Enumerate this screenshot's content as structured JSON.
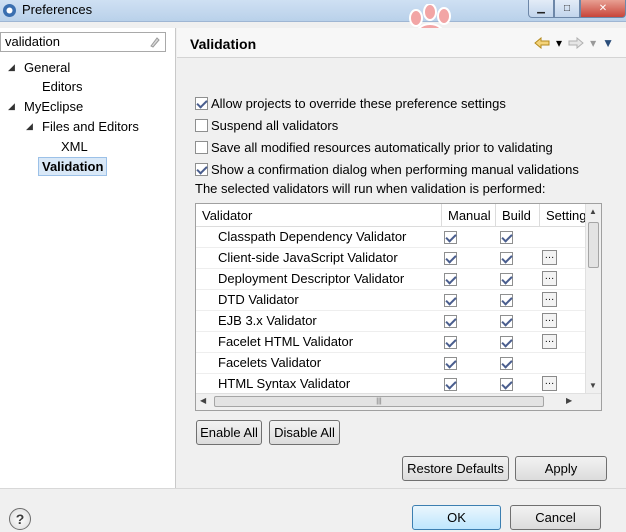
{
  "window": {
    "title": "Preferences",
    "min_glyph": "▁",
    "max_glyph": "□",
    "close_glyph": "✕"
  },
  "sidebar": {
    "filter_value": "validation",
    "tree": [
      {
        "label": "General",
        "expanded": true
      },
      {
        "label": "Editors"
      },
      {
        "label": "MyEclipse",
        "expanded": true
      },
      {
        "label": "Files and Editors",
        "expanded": true
      },
      {
        "label": "XML"
      },
      {
        "label": "Validation",
        "selected": true
      }
    ]
  },
  "page": {
    "title": "Validation",
    "options": [
      {
        "label": "Allow projects to override these preference settings",
        "checked": true
      },
      {
        "label": "Suspend all validators",
        "checked": false
      },
      {
        "label": "Save all modified resources automatically prior to validating",
        "checked": false
      },
      {
        "label": "Show a confirmation dialog when performing manual validations",
        "checked": true
      }
    ],
    "info_text": "The selected validators will run when validation is performed:",
    "table": {
      "columns": [
        "Validator",
        "Manual",
        "Build",
        "Settings"
      ],
      "rows": [
        {
          "name": "Classpath Dependency Validator",
          "manual": true,
          "build": true,
          "settings": false
        },
        {
          "name": "Client-side JavaScript Validator",
          "manual": true,
          "build": true,
          "settings": true
        },
        {
          "name": "Deployment Descriptor Validator",
          "manual": true,
          "build": true,
          "settings": true
        },
        {
          "name": "DTD Validator",
          "manual": true,
          "build": true,
          "settings": true
        },
        {
          "name": "EJB 3.x Validator",
          "manual": true,
          "build": true,
          "settings": true
        },
        {
          "name": "Facelet HTML Validator",
          "manual": true,
          "build": true,
          "settings": true
        },
        {
          "name": "Facelets Validator",
          "manual": true,
          "build": true,
          "settings": false
        },
        {
          "name": "HTML Syntax Validator",
          "manual": true,
          "build": true,
          "settings": true
        }
      ],
      "settings_glyph": "…"
    },
    "enable_all_label": "Enable All",
    "disable_all_label": "Disable All",
    "restore_defaults_label": "Restore Defaults",
    "apply_label": "Apply"
  },
  "footer": {
    "help_glyph": "?",
    "ok_label": "OK",
    "cancel_label": "Cancel"
  },
  "colors": {
    "accent": "#3c7fb1",
    "selection": "#d9e8f7",
    "paw": "#f2a5a5"
  }
}
